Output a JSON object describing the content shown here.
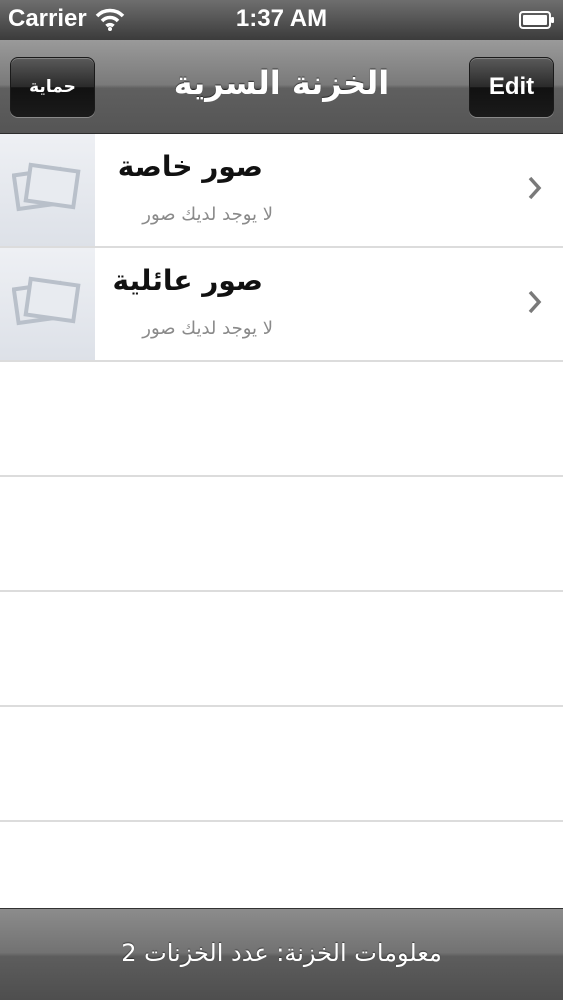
{
  "status_bar": {
    "carrier": "Carrier",
    "time": "1:37 AM",
    "wifi_icon": "wifi-icon",
    "battery_icon": "battery-icon"
  },
  "nav": {
    "title": "الخزنة السرية",
    "left_button": "حماية",
    "right_button": "Edit"
  },
  "albums": [
    {
      "title": "صور خاصة",
      "subtitle": "لا يوجد لديك صور",
      "thumb_icon": "photos-placeholder-icon"
    },
    {
      "title": "صور عائلية",
      "subtitle": "لا يوجد لديك صور",
      "thumb_icon": "photos-placeholder-icon"
    }
  ],
  "footer": {
    "info": "معلومات الخزنة:  عدد الخزنات 2"
  },
  "colors": {
    "bar_gray": "#6e6e6e",
    "separator": "#dcdcdc",
    "subtitle_gray": "#8a8a8a"
  }
}
